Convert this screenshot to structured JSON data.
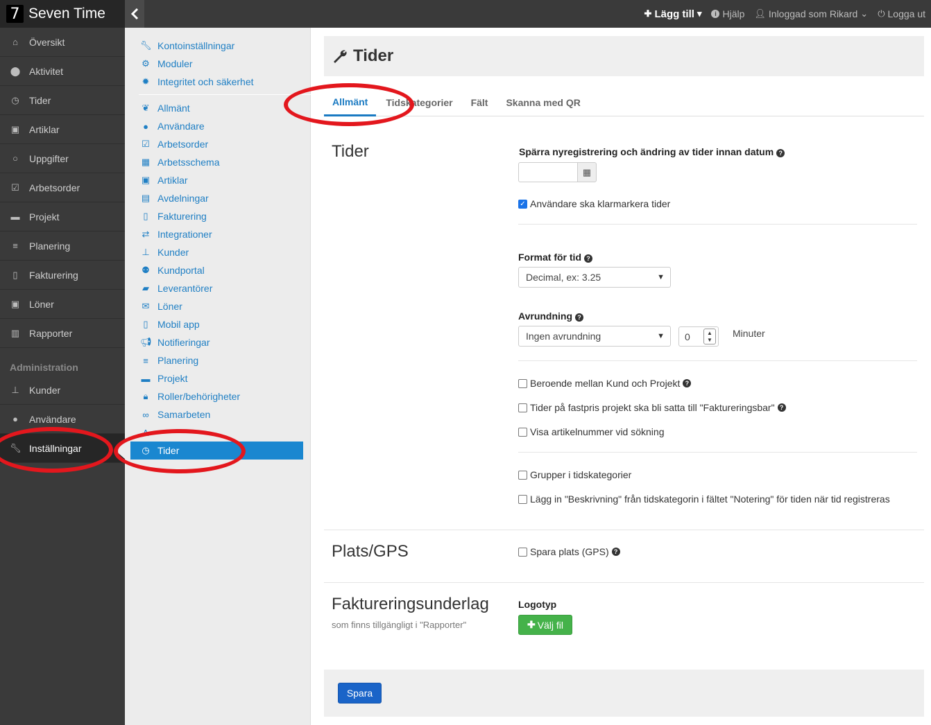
{
  "brand": {
    "logo_text": "7",
    "name": "Seven Time"
  },
  "topnav": {
    "add_label": "Lägg till",
    "help_label": "Hjälp",
    "user_label": "Inloggad som Rikard",
    "logout_label": "Logga ut"
  },
  "sidebar": {
    "items": [
      {
        "label": "Översikt",
        "icon": "home-icon"
      },
      {
        "label": "Aktivitet",
        "icon": "map-marker-icon"
      },
      {
        "label": "Tider",
        "icon": "clock-icon"
      },
      {
        "label": "Artiklar",
        "icon": "money-icon"
      },
      {
        "label": "Uppgifter",
        "icon": "circle-icon"
      },
      {
        "label": "Arbetsorder",
        "icon": "check-square-icon"
      },
      {
        "label": "Projekt",
        "icon": "briefcase-icon"
      },
      {
        "label": "Planering",
        "icon": "bars-icon"
      },
      {
        "label": "Fakturering",
        "icon": "file-icon"
      },
      {
        "label": "Löner",
        "icon": "money-icon"
      },
      {
        "label": "Rapporter",
        "icon": "bar-chart-icon"
      }
    ],
    "section_label": "Administration",
    "admin_items": [
      {
        "label": "Kunder",
        "icon": "sitemap-icon"
      },
      {
        "label": "Användare",
        "icon": "user-icon"
      },
      {
        "label": "Inställningar",
        "icon": "wrench-icon"
      }
    ]
  },
  "submenu": {
    "group1": [
      {
        "label": "Kontoinställningar",
        "icon": "wrench-icon"
      },
      {
        "label": "Moduler",
        "icon": "cogs-icon"
      },
      {
        "label": "Integritet och säkerhet",
        "icon": "certificate-icon"
      }
    ],
    "group2": [
      {
        "label": "Allmänt",
        "icon": "leaf-icon"
      },
      {
        "label": "Användare",
        "icon": "user-icon"
      },
      {
        "label": "Arbetsorder",
        "icon": "check-square-icon"
      },
      {
        "label": "Arbetsschema",
        "icon": "calendar-icon"
      },
      {
        "label": "Artiklar",
        "icon": "money-icon"
      },
      {
        "label": "Avdelningar",
        "icon": "clipboard-icon"
      },
      {
        "label": "Fakturering",
        "icon": "file-icon"
      },
      {
        "label": "Integrationer",
        "icon": "exchange-icon"
      },
      {
        "label": "Kunder",
        "icon": "sitemap-icon"
      },
      {
        "label": "Kundportal",
        "icon": "users-icon"
      },
      {
        "label": "Leverantörer",
        "icon": "truck-icon"
      },
      {
        "label": "Löner",
        "icon": "envelope-icon"
      },
      {
        "label": "Mobil app",
        "icon": "mobile-icon"
      },
      {
        "label": "Notifieringar",
        "icon": "bullhorn-icon"
      },
      {
        "label": "Planering",
        "icon": "bars-icon"
      },
      {
        "label": "Projekt",
        "icon": "briefcase-icon"
      },
      {
        "label": "Roller/behörigheter",
        "icon": "lock-icon"
      },
      {
        "label": "Samarbeten",
        "icon": "handshake-icon"
      },
      {
        "label": "Tider",
        "icon": "clock-icon"
      }
    ]
  },
  "page": {
    "title": "Tider",
    "tabs": [
      "Allmänt",
      "Tidskategorier",
      "Fält",
      "Skanna med QR"
    ]
  },
  "sections": {
    "tider": {
      "title": "Tider",
      "lock_label": "Spärra nyregistrering och ändring av tider innan datum",
      "date_value": "",
      "confirm_label": "Användare ska klarmarkera tider",
      "format_label": "Format för tid",
      "format_value": "Decimal, ex: 3.25",
      "rounding_label": "Avrundning",
      "rounding_value": "Ingen avrundning",
      "rounding_minutes": "0",
      "minutes_unit": "Minuter",
      "dep_label": "Beroende mellan Kund och Projekt",
      "fixed_label": "Tider på fastpris projekt ska bli satta till \"Faktureringsbar\"",
      "artnr_label": "Visa artikelnummer vid sökning",
      "groups_label": "Grupper i tidskategorier",
      "desc_label": "Lägg in \"Beskrivning\" från tidskategorin i fältet \"Notering\" för tiden när tid registreras"
    },
    "gps": {
      "title": "Plats/GPS",
      "save_gps_label": "Spara plats (GPS)"
    },
    "billing": {
      "title": "Faktureringsunderlag",
      "subtitle": "som finns tillgängligt i \"Rapporter\"",
      "logo_label": "Logotyp",
      "choose_file_label": "Välj fil"
    }
  },
  "footer": {
    "save_label": "Spara"
  },
  "colors": {
    "accent": "#1a87d0",
    "annotation": "#e3171d",
    "success": "#45b24a",
    "primary": "#1a64c8"
  }
}
